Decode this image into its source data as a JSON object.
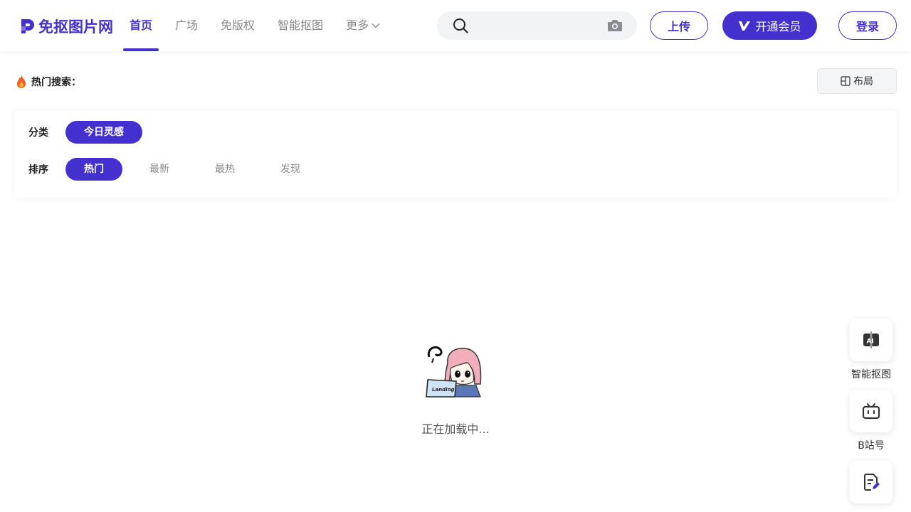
{
  "brand": {
    "name": "免抠图片网",
    "accent": "#4330cf"
  },
  "nav": {
    "items": [
      {
        "label": "首页",
        "active": true
      },
      {
        "label": "广场"
      },
      {
        "label": "免版权"
      },
      {
        "label": "智能抠图"
      },
      {
        "label": "更多"
      }
    ]
  },
  "search": {
    "value": "",
    "placeholder": ""
  },
  "header_actions": {
    "upload": "上传",
    "vip": "开通会员",
    "login": "登录"
  },
  "hot_search": {
    "label": "热门搜索："
  },
  "layout_button": {
    "label": "布局"
  },
  "filters": {
    "category": {
      "label": "分类",
      "options": [
        "今日灵感"
      ],
      "selected": "今日灵感"
    },
    "sort": {
      "label": "排序",
      "options": [
        "热门",
        "最新",
        "最热",
        "发现"
      ],
      "selected": "热门"
    }
  },
  "loading": {
    "text": "正在加载中...",
    "image_caption": "Landing."
  },
  "float_bar": {
    "items": [
      {
        "label": "智能抠图",
        "icon": "ai-cutout-icon"
      },
      {
        "label": "B站号",
        "icon": "bilibili-icon"
      },
      {
        "label": "",
        "icon": "feedback-edit-icon"
      }
    ]
  }
}
